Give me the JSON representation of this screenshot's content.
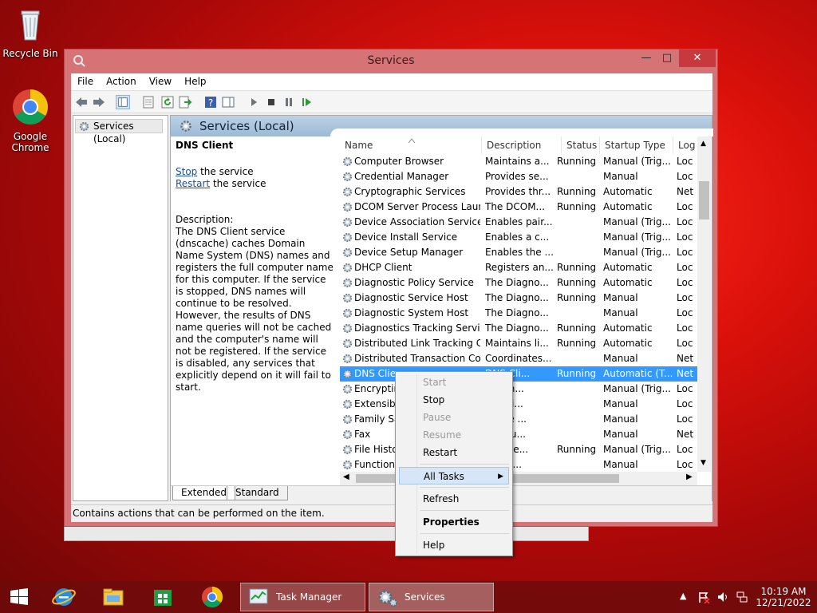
{
  "desktop": {
    "icons": [
      {
        "label": "Recycle Bin"
      },
      {
        "label": "Google Chrome"
      }
    ]
  },
  "window": {
    "title": "Services",
    "menu": [
      "File",
      "Action",
      "View",
      "Help"
    ],
    "tree_node": "Services (Local)",
    "pane_title": "Services (Local)",
    "description": {
      "service_name": "DNS Client",
      "stop_link": "Stop",
      "stop_rest": " the service",
      "restart_link": "Restart",
      "restart_rest": " the service",
      "label": "Description:",
      "text": "The DNS Client service (dnscache) caches Domain Name System (DNS) names and registers the full computer name for this computer. If the service is stopped, DNS names will continue to be resolved. However, the results of DNS name queries will not be cached and the computer's name will not be registered. If the service is disabled, any services that explicitly depend on it will fail to start."
    },
    "columns": [
      "Name",
      "Description",
      "Status",
      "Startup Type",
      "Log"
    ],
    "rows": [
      {
        "name": "Computer Browser",
        "desc": "Maintains a...",
        "status": "Running",
        "startup": "Manual (Trig...",
        "log": "Loc"
      },
      {
        "name": "Credential Manager",
        "desc": "Provides se...",
        "status": "",
        "startup": "Manual",
        "log": "Loc"
      },
      {
        "name": "Cryptographic Services",
        "desc": "Provides thr...",
        "status": "Running",
        "startup": "Automatic",
        "log": "Net"
      },
      {
        "name": "DCOM Server Process Laun...",
        "desc": "The DCOM...",
        "status": "Running",
        "startup": "Automatic",
        "log": "Loc"
      },
      {
        "name": "Device Association Service",
        "desc": "Enables pair...",
        "status": "",
        "startup": "Manual (Trig...",
        "log": "Loc"
      },
      {
        "name": "Device Install Service",
        "desc": "Enables a c...",
        "status": "",
        "startup": "Manual (Trig...",
        "log": "Loc"
      },
      {
        "name": "Device Setup Manager",
        "desc": "Enables the ...",
        "status": "",
        "startup": "Manual (Trig...",
        "log": "Loc"
      },
      {
        "name": "DHCP Client",
        "desc": "Registers an...",
        "status": "Running",
        "startup": "Automatic",
        "log": "Loc"
      },
      {
        "name": "Diagnostic Policy Service",
        "desc": "The Diagno...",
        "status": "Running",
        "startup": "Automatic",
        "log": "Loc"
      },
      {
        "name": "Diagnostic Service Host",
        "desc": "The Diagno...",
        "status": "Running",
        "startup": "Manual",
        "log": "Loc"
      },
      {
        "name": "Diagnostic System Host",
        "desc": "The Diagno...",
        "status": "",
        "startup": "Manual",
        "log": "Loc"
      },
      {
        "name": "Diagnostics Tracking Service",
        "desc": "The Diagno...",
        "status": "Running",
        "startup": "Automatic",
        "log": "Loc"
      },
      {
        "name": "Distributed Link Tracking Cl...",
        "desc": "Maintains li...",
        "status": "Running",
        "startup": "Automatic",
        "log": "Loc"
      },
      {
        "name": "Distributed Transaction Co...",
        "desc": "Coordinates...",
        "status": "",
        "startup": "Manual",
        "log": "Net"
      },
      {
        "name": "DNS Clie",
        "desc": "DNS Cli...",
        "status": "Running",
        "startup": "Automatic (T...",
        "log": "Net"
      },
      {
        "name": "Encryptin",
        "desc": "des th...",
        "status": "",
        "startup": "Manual (Trig...",
        "log": "Loc"
      },
      {
        "name": "Extensibl",
        "desc": "xtensi...",
        "status": "",
        "startup": "Manual",
        "log": "Loc"
      },
      {
        "name": "Family Sa",
        "desc": "ervice ...",
        "status": "",
        "startup": "Manual",
        "log": "Loc"
      },
      {
        "name": "Fax",
        "desc": "es you...",
        "status": "",
        "startup": "Manual",
        "log": "Net"
      },
      {
        "name": "File Histo",
        "desc": "cts use...",
        "status": "Running",
        "startup": "Manual (Trig...",
        "log": "Loc"
      },
      {
        "name": "Function",
        "desc": "DPHO...",
        "status": "",
        "startup": "Manual",
        "log": "Loc"
      }
    ],
    "tabs": [
      "Extended",
      "Standard"
    ],
    "status_bar": "Contains actions that can be performed on the item."
  },
  "context_menu": {
    "start": "Start",
    "stop": "Stop",
    "pause": "Pause",
    "resume": "Resume",
    "restart": "Restart",
    "all_tasks": "All Tasks",
    "refresh": "Refresh",
    "properties": "Properties",
    "help": "Help"
  },
  "taskbar": {
    "tasks": [
      {
        "label": "Task Manager"
      },
      {
        "label": "Services"
      }
    ],
    "clock_time": "10:19 AM",
    "clock_date": "12/21/2022"
  },
  "colors": {
    "accent": "#3399ff",
    "window_frame": "#d67377",
    "close_button": "#c7393d",
    "link": "#1c4fa6"
  }
}
